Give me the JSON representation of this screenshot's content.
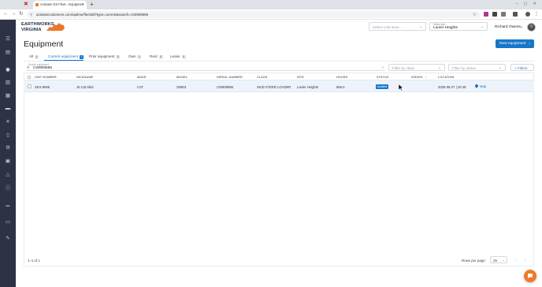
{
  "browser": {
    "tab_title": "Activate OS Fleet - Equipmen",
    "tab_close": "×",
    "new_tab": "+",
    "url": "activatecustomers.com/uptime/fleet/all?type=current&search=CW909596"
  },
  "header": {
    "logo_line1": "EARTHWORKS",
    "logo_line2": "VIRGINIA",
    "cost_area_placeholder": "Select cost area...",
    "site_caption": "Select site...",
    "site_value": "Lanier Heights",
    "user_name": "Richard Owens"
  },
  "page": {
    "title": "Equipment",
    "new_button": "New equipment"
  },
  "filter_tabs": [
    {
      "label": "All",
      "count": "1"
    },
    {
      "label": "Current equipment",
      "count": "1"
    },
    {
      "label": "Prior equipment",
      "count": "0"
    },
    {
      "label": "Own",
      "count": "1"
    },
    {
      "label": "Rent",
      "count": "0"
    },
    {
      "label": "Lease",
      "count": "0"
    }
  ],
  "search": {
    "caption": "Search equipment",
    "value": "CW909596",
    "class_placeholder": "Filter by class",
    "status_placeholder": "Filter by status",
    "filters_button": "+ Filters"
  },
  "table": {
    "columns": [
      "UNIT NUMBER",
      "NICKNAME",
      "MAKE",
      "MODEL",
      "SERIAL NUMBER",
      "CLASS",
      "SITE",
      "HOURS",
      "STATUS",
      "ISSUES",
      "LOCATION"
    ],
    "rows": [
      {
        "unit_number": "SKS-9596",
        "nickname": "J5 Cat Skid",
        "make": "CAT",
        "model": "259D3",
        "serial_number": "CW909596",
        "class": "SKID STEER LOADER",
        "site": "Lanier Heights",
        "hours": "856.0",
        "status": "Available",
        "issues": "",
        "location_time": "2025-05-27 | 20:49",
        "location_link": "Map"
      }
    ]
  },
  "footer": {
    "count": "1–1 of 1",
    "rows_per_page_label": "Rows per page:",
    "rows_per_page_value": "25"
  },
  "colors": {
    "primary": "#1677c9",
    "sidebar": "#2d3345",
    "row_highlight": "#eef3fb",
    "brand_orange": "#e8782a"
  }
}
